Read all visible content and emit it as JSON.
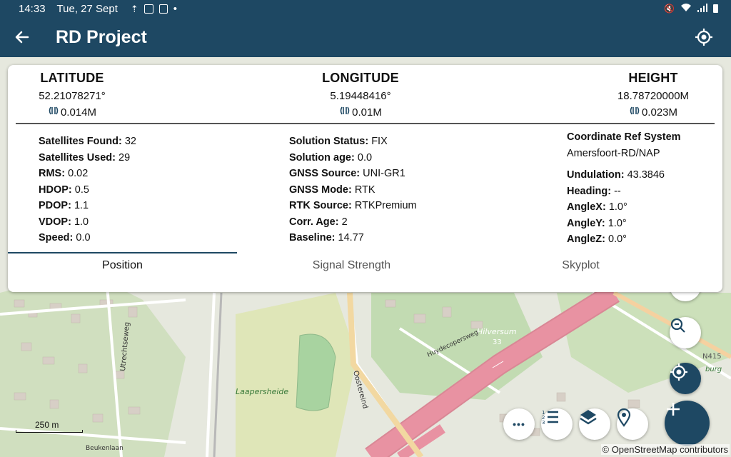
{
  "status_bar": {
    "time": "14:33",
    "date": "Tue, 27 Sept",
    "dot": "•"
  },
  "app_bar": {
    "title": "RD Project"
  },
  "position": {
    "latitude": {
      "header": "LATITUDE",
      "value": "52.21078271°",
      "accuracy": "0.014M"
    },
    "longitude": {
      "header": "LONGITUDE",
      "value": "5.19448416°",
      "accuracy": "0.01M"
    },
    "height": {
      "header": "HEIGHT",
      "value": "18.78720000M",
      "accuracy": "0.023M"
    }
  },
  "stats_left": [
    {
      "label": "Satellites Found:",
      "value": "32"
    },
    {
      "label": "Satellites Used:",
      "value": "29"
    },
    {
      "label": "RMS:",
      "value": "0.02"
    },
    {
      "label": "HDOP:",
      "value": "0.5"
    },
    {
      "label": "PDOP:",
      "value": "1.1"
    },
    {
      "label": "VDOP:",
      "value": "1.0"
    },
    {
      "label": "Speed:",
      "value": "0.0"
    }
  ],
  "stats_mid": [
    {
      "label": "Solution Status:",
      "value": "FIX"
    },
    {
      "label": "Solution age:",
      "value": "0.0"
    },
    {
      "label": "GNSS Source:",
      "value": "UNI-GR1"
    },
    {
      "label": "GNSS Mode:",
      "value": "RTK"
    },
    {
      "label": "RTK Source:",
      "value": "RTKPremium"
    },
    {
      "label": "Corr. Age:",
      "value": "2"
    },
    {
      "label": "Baseline:",
      "value": "14.77"
    }
  ],
  "stats_right": {
    "crs_label": "Coordinate Ref System",
    "crs_value": "Amersfoort-RD/NAP",
    "items": [
      {
        "label": "Undulation:",
        "value": "43.3846"
      },
      {
        "label": "Heading:",
        "value": "--"
      },
      {
        "label": "AngleX:",
        "value": "1.0°"
      },
      {
        "label": "AngleY:",
        "value": "1.0°"
      },
      {
        "label": "AngleZ:",
        "value": "0.0°"
      }
    ]
  },
  "tabs": [
    {
      "label": "Position",
      "active": true
    },
    {
      "label": "Signal Strength",
      "active": false
    },
    {
      "label": "Skyplot",
      "active": false
    }
  ],
  "map": {
    "labels": {
      "laapersheide": "Laapersheide",
      "hilversum": "Hilversum",
      "road_33": "33",
      "n415": "N415",
      "utrechtseweg": "Utrechtseweg",
      "oostereind": "Oostereind",
      "beukenlaan": "Beukenlaan",
      "huydecopersweg": "Huydecopersweg",
      "burg": "burg"
    },
    "scale_label": "250 m",
    "attribution": "© OpenStreetMap contributors"
  },
  "fab_more": "•••",
  "colors": {
    "appbar": "#1e4863",
    "motorway": "#e892a2",
    "park": "#cde9b9",
    "forest": "#add19e",
    "fab_primary": "#1e4863"
  }
}
